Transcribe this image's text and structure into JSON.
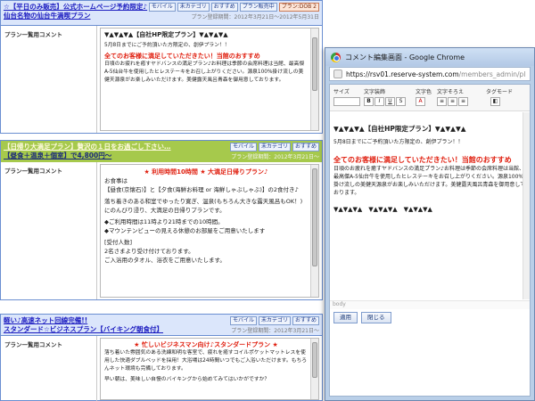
{
  "plans": [
    {
      "title_lines": [
        "☆【平日のみ販売】公式ホームページ予約限定♪",
        "仙台名物の仙台牛満喫プラン"
      ],
      "tags": [
        "モバイル",
        "未カテゴリ",
        "おすすめ",
        "プラン販売中",
        "プラン:DOB 2"
      ],
      "date": "プラン登録期間：2012年3月21日～2012年5月31日",
      "label": "プラン一覧用コメント",
      "comment": {
        "line1": "▼▲▼▲▼▲【自社HP限定プラン】▼▲▼▲▼▲",
        "line2": "5月8日までにご予約頂いた方限定の、創伊プラン！！",
        "headline": "全てのお客様に満足していただきたい！当館のおすすめ",
        "body": "日頃のお疲れを癒すヤドバンスの満足プラン♪お料理は季節の会席料理は当館、最高傑A-5仙台牛を使用したヒレステーキをお召し上がりください。源泉100%掛け流しの美健天源泉がお楽しみいただけます。美健露天風呂青森を御用意しております。"
      }
    },
    {
      "title_lines": [
        "【日帰り大満足プラン】贅沢の１日をお過ごし下さい…",
        "【昼食＋温泉＋個室】で4,800円～"
      ],
      "tags": [
        "モバイル",
        "未カテゴリ",
        "おすすめ"
      ],
      "date": "プラン登録期間：2012年3月21日～",
      "label": "プラン一覧用コメント",
      "comment": {
        "headline": "★ 利用時間10時間 ★ 大満足日帰りプラン♪",
        "lines": [
          "お食事は",
          "【昼食(京懐石)】と【夕食(海鮮お料理 or 海鮮しゃぶしゃぶ)】の2食付き♪",
          "落ち着きのある和室でゆったり寛ぎ、温泉(もちろん大きな露天風呂もOK！)にのんびり浸り、大満足の日帰りプランです。",
          "◆ご利用時間は11時より21時までの10時間。",
          "◆マウンテンビューの見える休憩のお部屋をご用意いたします",
          "[受付人数]",
          "2名さまより受け付けております。",
          "ご入浴用のタオル、浴衣をご用意いたします。"
        ]
      }
    },
    {
      "title_lines": [
        "軽い♪高速ネット回線完備!!",
        "スタンダード☆ビジネスプラン【バイキング朝食付】"
      ],
      "tags": [
        "モバイル",
        "未カテゴリ",
        "おすすめ"
      ],
      "date": "プラン登録期間：2012年3月21日～",
      "label": "プラン一覧用コメント",
      "comment": {
        "headline": "★ 忙しいビジネスマン向け♪スタンダードプラン ★",
        "body": "落ち着いた雰囲気のある洗練和明な客室で、疲れを癒すコイルポケットマットレスを使用した快適ダブルベッドを採用！大浴場は24時間いつでもご入浴いただけます。もちろんネット環境も完備しております。",
        "extra": "早い朝は、美味しい自慢のバイキングから始めてみてはいかがですか？"
      }
    }
  ],
  "popup": {
    "title": "コメント編集画面 - Google Chrome",
    "url_host": "https://rsv01.reserve-system.com",
    "url_path": "/members_admin/pl",
    "toolbar": {
      "size_label": "サイズ",
      "decor_label": "文字装飾",
      "color_label": "文字色",
      "align_label": "文字そろえ",
      "tag_label": "タグモード"
    },
    "content": {
      "line1": "▼▲▼▲▼▲【自社HP限定プラン】▼▲▼▲▼▲",
      "line2": "5月8日までにご予約頂いた方限定の、創伊プラン！！",
      "headline": "全てのお客様に満足していただきたい！当館のおすすめ",
      "body": "日頃のお疲れを癒すヤドバンスの満足プラン♪お料理は季節の会席料理は当館、最高傑A-5仙台牛を使用したヒレステーキをお召し上がりください。源泉100%掛け流しの美健天源泉がお楽しみいただけます。美健露天風呂青森を御用意しております。",
      "line_end": "▼▲▼▲▼▲　▼▲▼▲▼▲　▼▲▼▲▼▲"
    },
    "status": "body",
    "apply_label": "適用",
    "close_label": "閉じる"
  },
  "colors": {
    "accent_red": "#e02010",
    "header_blue": "#dbe6fb",
    "header_green": "#a6c94c"
  }
}
